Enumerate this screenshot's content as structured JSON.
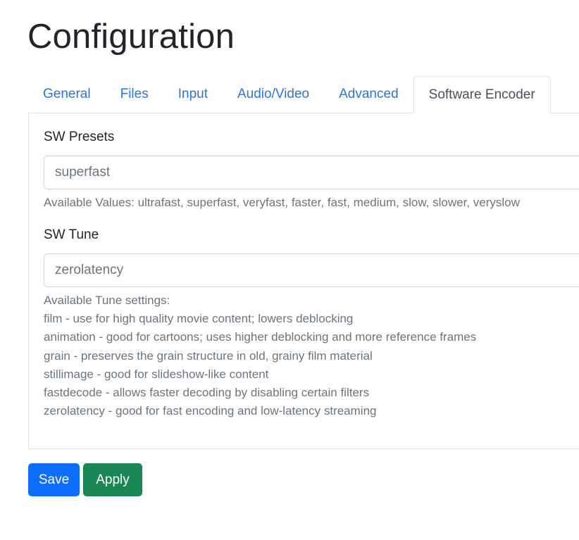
{
  "page": {
    "title": "Configuration"
  },
  "tabs": [
    {
      "label": "General",
      "active": false
    },
    {
      "label": "Files",
      "active": false
    },
    {
      "label": "Input",
      "active": false
    },
    {
      "label": "Audio/Video",
      "active": false
    },
    {
      "label": "Advanced",
      "active": false
    },
    {
      "label": "Software Encoder",
      "active": true
    }
  ],
  "form": {
    "presets": {
      "label": "SW Presets",
      "value": "superfast",
      "help": "Available Values: ultrafast, superfast, veryfast, faster, fast, medium, slow, slower, veryslow"
    },
    "tune": {
      "label": "SW Tune",
      "value": "zerolatency",
      "help_lines": [
        "Available Tune settings:",
        "film - use for high quality movie content; lowers deblocking",
        "animation - good for cartoons; uses higher deblocking and more reference frames",
        "grain - preserves the grain structure in old, grainy film material",
        "stillimage - good for slideshow-like content",
        "fastdecode - allows faster decoding by disabling certain filters",
        "zerolatency - good for fast encoding and low-latency streaming"
      ]
    }
  },
  "buttons": {
    "save_label": "Save",
    "apply_label": "Apply"
  },
  "colors": {
    "link": "#2f74d8",
    "primary": "#0d6efd",
    "success": "#198754",
    "muted": "#6c757d"
  }
}
